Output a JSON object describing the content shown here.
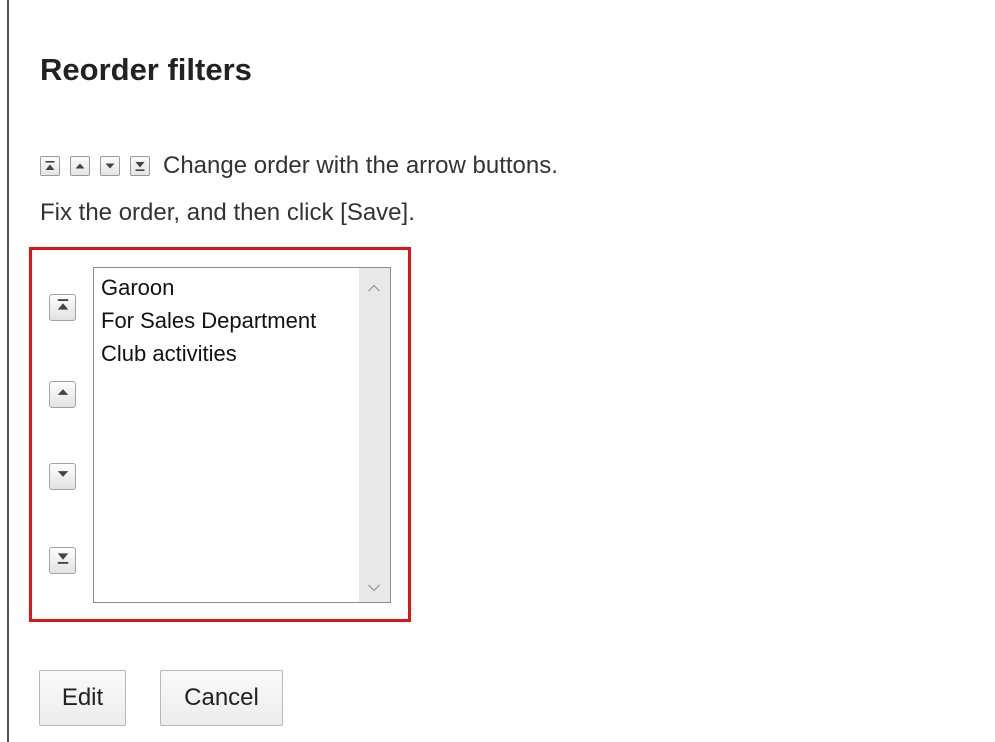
{
  "page": {
    "title": "Reorder filters"
  },
  "hint": {
    "line1": "Change order with the arrow buttons.",
    "line2": "Fix the order, and then click [Save].",
    "icons": [
      "move-top-icon",
      "move-up-icon",
      "move-down-icon",
      "move-bottom-icon"
    ]
  },
  "order_list": {
    "items": [
      "Garoon",
      "For Sales Department",
      "Club activities"
    ]
  },
  "controls": {
    "move_buttons": [
      "move-top",
      "move-up",
      "move-down",
      "move-bottom"
    ]
  },
  "actions": {
    "edit_label": "Edit",
    "cancel_label": "Cancel"
  },
  "colors": {
    "highlight": "#e01414",
    "scrollbar_track": "#e8e8e8"
  }
}
